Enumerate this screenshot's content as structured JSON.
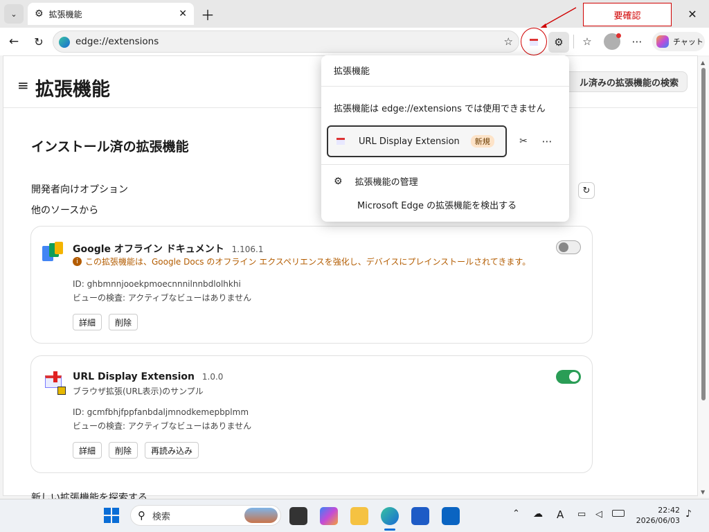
{
  "tab": {
    "title": "拡張機能"
  },
  "address": {
    "url": "edge://extensions"
  },
  "toolbar": {
    "chat_label": "チャット"
  },
  "annotation": {
    "label": "要確認"
  },
  "page": {
    "title": "拡張機能",
    "search_placeholder": "ル済みの拡張機能の検索",
    "section_title": "インストール済の拡張機能",
    "dev_options": "開発者向けオプション",
    "other_sources": "他のソースから",
    "find_more": "新しい拡張機能を探索する"
  },
  "extensions": [
    {
      "name": "Google オフライン ドキュメント",
      "version": "1.106.1",
      "warning": "この拡張機能は、Google Docs のオフライン エクスペリエンスを強化し、デバイスにプレインストールされてきます。",
      "id_line": "ID: ghbmnnjooekpmoecnnnilnnbdlolhkhi",
      "inspect_line": "ビューの検査: アクティブなビューはありません",
      "details_label": "詳細",
      "remove_label": "削除",
      "enabled": false
    },
    {
      "name": "URL Display Extension",
      "version": "1.0.0",
      "description": "ブラウザ拡張(URL表示)のサンプル",
      "id_line": "ID: gcmfbhjfppfanbdaljmnodkemepbplmm",
      "inspect_line": "ビューの検査: アクティブなビューはありません",
      "details_label": "詳細",
      "remove_label": "削除",
      "reload_label": "再読み込み",
      "enabled": true
    }
  ],
  "popup": {
    "title": "拡張機能",
    "notice": "拡張機能は edge://extensions では使用できません",
    "item_name": "URL Display Extension",
    "item_badge": "新規",
    "manage_label": "拡張機能の管理",
    "discover_label": "Microsoft Edge の拡張機能を検出する"
  },
  "taskbar": {
    "search_placeholder": "検索",
    "time": "22:42",
    "date": "2026/06/03",
    "ime": "A"
  },
  "colors": {
    "accent_green": "#2a9d56",
    "annotation_red": "#d00000",
    "warning": "#b35c00"
  }
}
